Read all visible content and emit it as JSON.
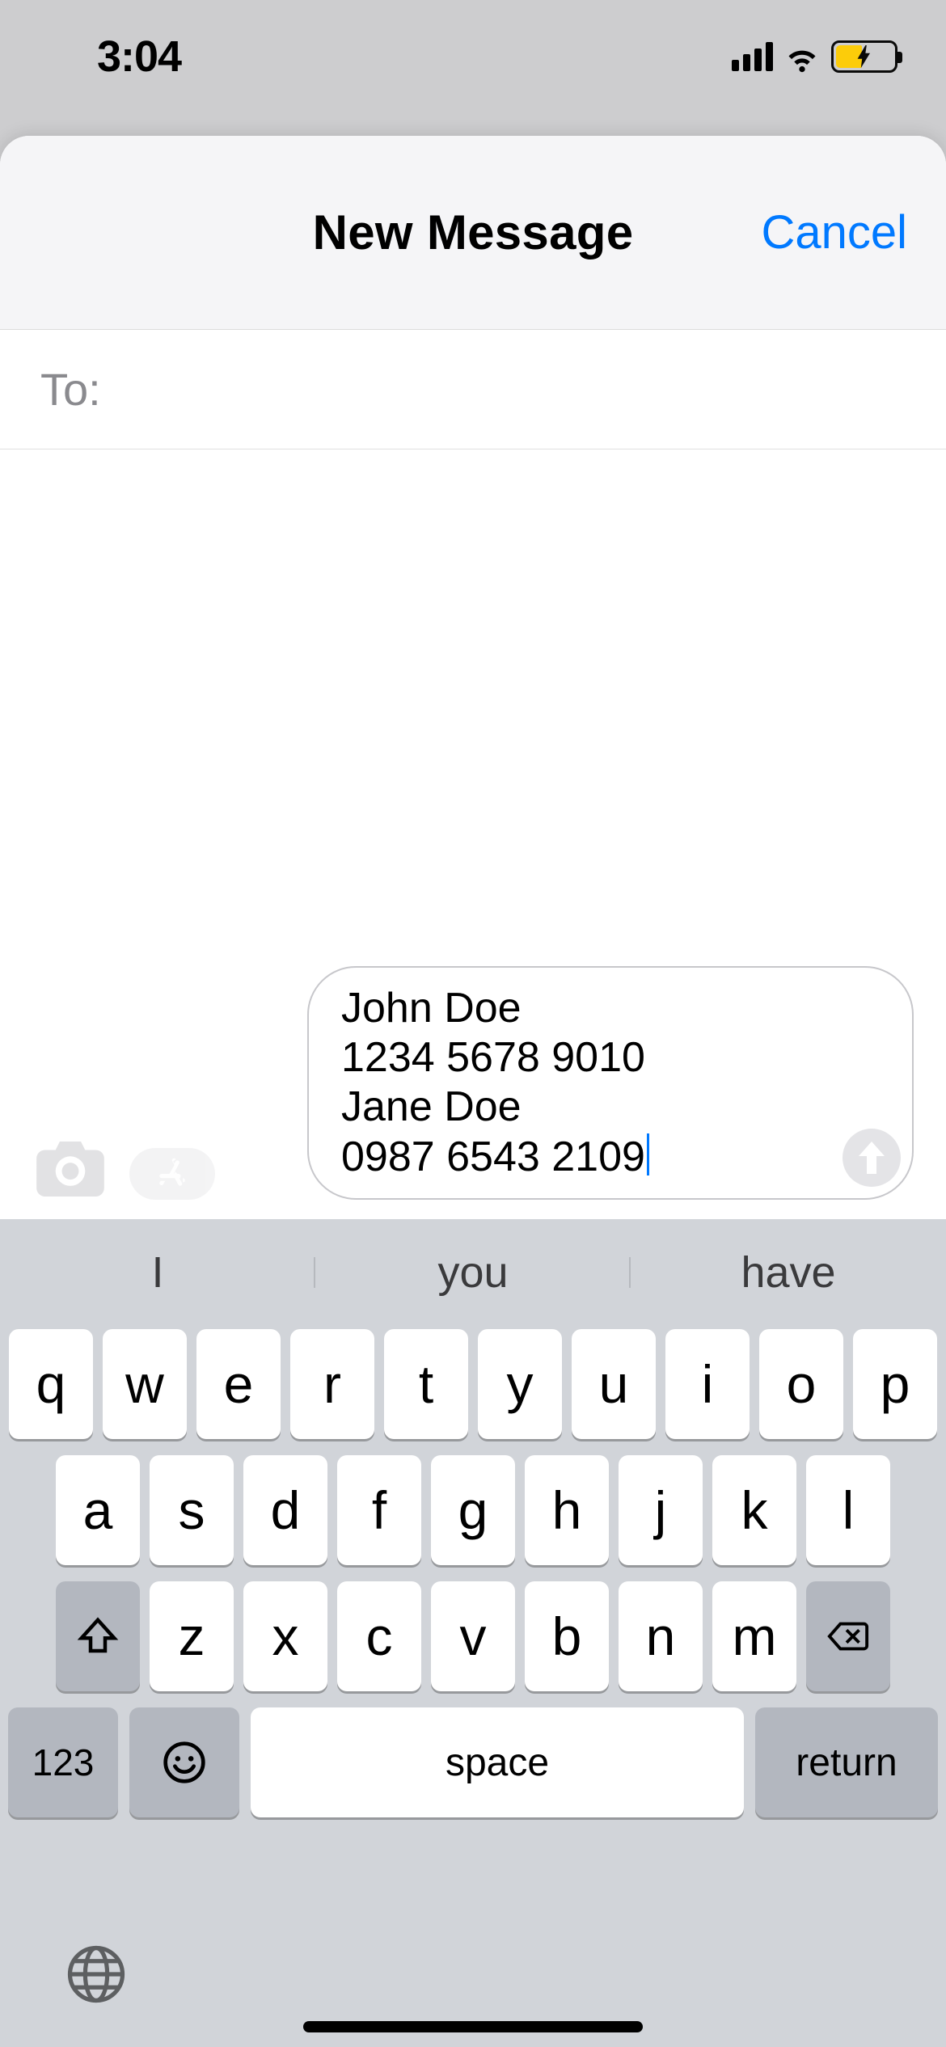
{
  "status": {
    "time": "3:04"
  },
  "sheet": {
    "title": "New Message",
    "cancel": "Cancel"
  },
  "to": {
    "label": "To:",
    "value": ""
  },
  "message": {
    "lines": [
      "John Doe",
      "1234 5678 9010",
      "Jane Doe",
      "0987 6543 2109"
    ]
  },
  "suggestions": [
    "I",
    "you",
    "have"
  ],
  "keyboard": {
    "row1": [
      "q",
      "w",
      "e",
      "r",
      "t",
      "y",
      "u",
      "i",
      "o",
      "p"
    ],
    "row2": [
      "a",
      "s",
      "d",
      "f",
      "g",
      "h",
      "j",
      "k",
      "l"
    ],
    "row3": [
      "z",
      "x",
      "c",
      "v",
      "b",
      "n",
      "m"
    ],
    "key_123": "123",
    "space": "space",
    "return": "return"
  },
  "colors": {
    "accent": "#0079ff",
    "battery_fill": "#ffcc00"
  }
}
